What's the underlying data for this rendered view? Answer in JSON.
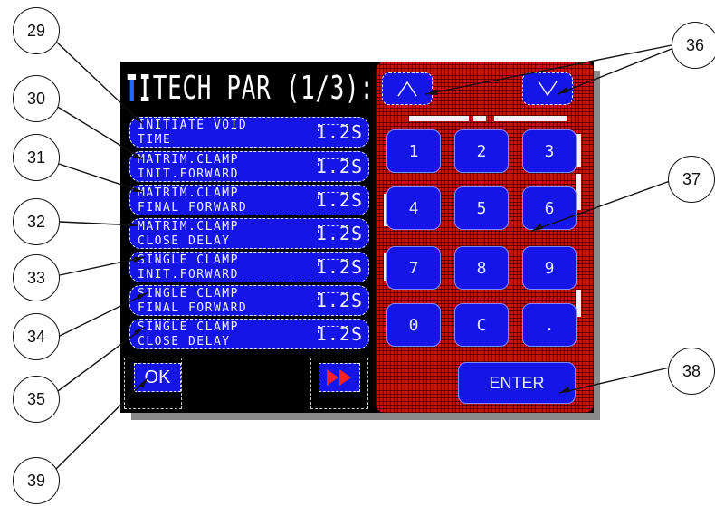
{
  "screen": {
    "title": "TECH PAR (1/3):",
    "params": [
      {
        "line1": "INITIATE VOID",
        "line2": "TIME",
        "value": "1.2S"
      },
      {
        "line1": "MATRIM.CLAMP",
        "line2": "INIT.FORWARD",
        "value": "1.2S"
      },
      {
        "line1": "MATRIM.CLAMP",
        "line2": "FINAL FORWARD",
        "value": "1.2S"
      },
      {
        "line1": "MATRIM.CLAMP",
        "line2": "CLOSE DELAY",
        "value": "1.2S"
      },
      {
        "line1": "SINGLE CLAMP",
        "line2": "INIT.FORWARD",
        "value": "1.2S"
      },
      {
        "line1": "SINGLE CLAMP",
        "line2": "FINAL FORWARD",
        "value": "1.2S"
      },
      {
        "line1": "SINGLE CLAMP",
        "line2": "CLOSE DELAY",
        "value": "1.2S"
      }
    ],
    "ok_label": "OK",
    "next_icon": "double-arrow-right-icon",
    "keypad": {
      "keys": [
        "1",
        "2",
        "3",
        "4",
        "5",
        "6",
        "7",
        "8",
        "9",
        "0",
        "C",
        "."
      ],
      "enter_label": "ENTER",
      "up_icon": "arrow-up-icon",
      "down_icon": "arrow-down-icon"
    }
  },
  "callouts": [
    "29",
    "30",
    "31",
    "32",
    "33",
    "34",
    "35",
    "36",
    "37",
    "38",
    "39"
  ],
  "colors": {
    "button_blue": "#1515e8",
    "keypad_red": "#c31414",
    "panel_black": "#000000"
  }
}
